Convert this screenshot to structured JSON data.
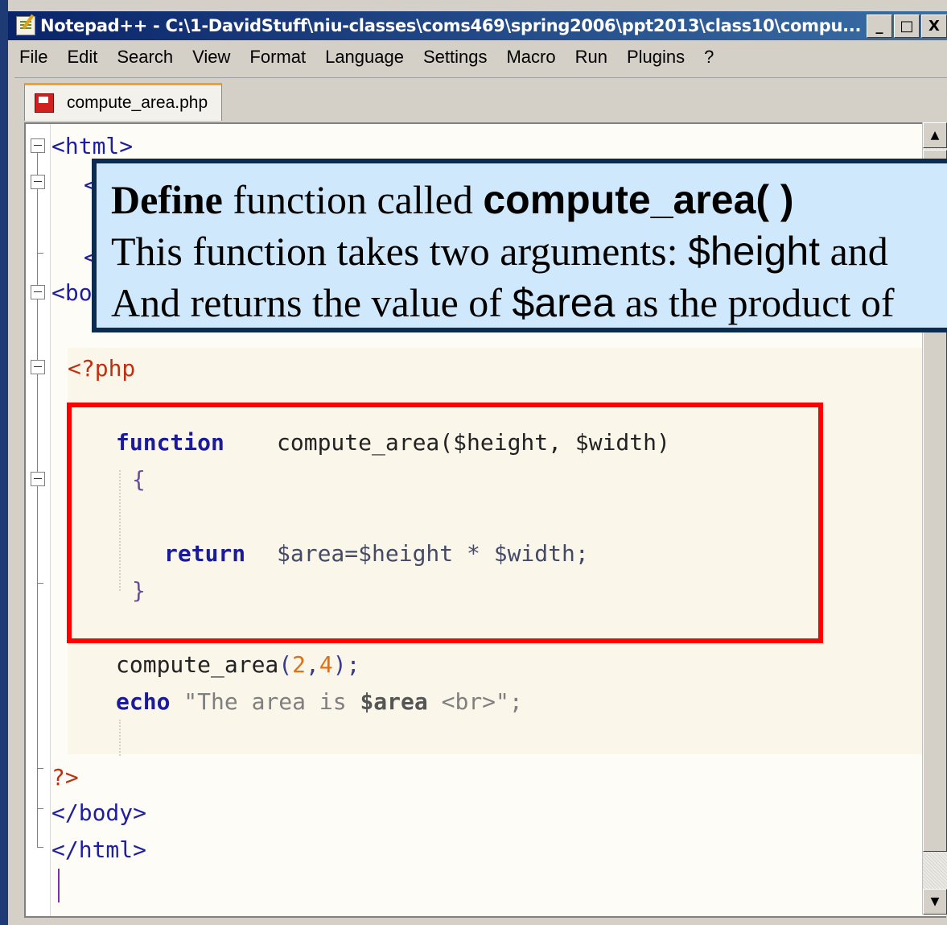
{
  "window": {
    "title": "Notepad++ - C:\\1-DavidStuff\\niu-classes\\coms469\\spring2006\\ppt2013\\class10\\compu...",
    "buttons": {
      "minimize": "_",
      "maximize": "□",
      "close": "X"
    }
  },
  "menu": [
    "File",
    "Edit",
    "Search",
    "View",
    "Format",
    "Language",
    "Settings",
    "Macro",
    "Run",
    "Plugins",
    "?"
  ],
  "tab": {
    "label": "compute_area.php"
  },
  "code": {
    "html_open": "<html>",
    "body_partial": "<bo",
    "head_partial_1": "<",
    "head_partial_2": "<",
    "php_open": "<?php",
    "function_kw": "function",
    "function_sig": "compute_area($height, $width)",
    "brace_open": "{",
    "return_kw": "return",
    "return_expr": "$area=$height * $width;",
    "brace_close": "}",
    "call_name": "compute_area",
    "call_paren_open": "(",
    "call_arg1": "2",
    "call_comma": ",",
    "call_arg2": "4",
    "call_paren_close": ");",
    "echo_kw": "echo",
    "echo_str_start": "\"The area is ",
    "echo_str_var": "$area",
    "echo_str_end": " <br>\";",
    "php_close": "?>",
    "body_close": "</body>",
    "html_close": "</html>"
  },
  "callout": {
    "line1_bold_serif": "Define",
    "line1_text": " function called ",
    "line1_bold_sans": "compute_area( )",
    "line2_text": "This function takes two arguments: ",
    "line2_sans": "$height",
    "line2_tail": " and",
    "line3_text": "And returns the value of ",
    "line3_sans": "$area",
    "line3_tail": " as the product of"
  },
  "scrollbar": {
    "up": "▲",
    "down": "▼"
  }
}
